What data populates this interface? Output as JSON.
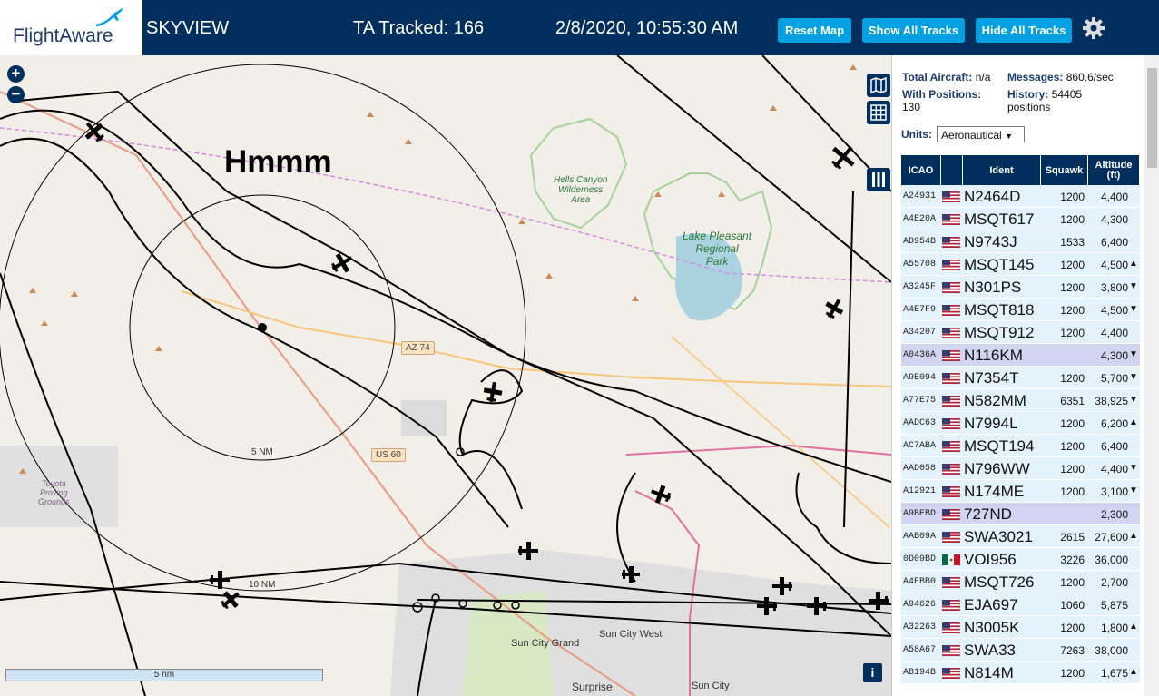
{
  "header": {
    "logo_text": "FlightAware",
    "app_name": "SKYVIEW",
    "tracked": "TA Tracked: 166",
    "datetime": "2/8/2020, 10:55:30 AM",
    "buttons": {
      "reset": "Reset Map",
      "show": "Show All Tracks",
      "hide": "Hide All Tracks"
    }
  },
  "map": {
    "annotation": "Hmmm",
    "zoom_in": "+",
    "zoom_out": "−",
    "ring_label_inner": "5 NM",
    "ring_label_outer": "10 NM",
    "roads": {
      "az74": "AZ 74",
      "us60": "US 60"
    },
    "places": {
      "hells_canyon": "Hells Canyon\nWilderness\nArea",
      "lake_pleasant": "Lake Pleasant\nRegional\nPark",
      "toyota": "Toyota\nProving\nGrounds",
      "sun_city_grand": "Sun City Grand",
      "sun_city_west": "Sun City West",
      "surprise": "Surprise",
      "sun_city": "Sun City"
    },
    "scale_label": "5 nm",
    "info": "i"
  },
  "panel": {
    "total_aircraft_label": "Total Aircraft:",
    "total_aircraft_value": "n/a",
    "messages_label": "Messages:",
    "messages_value": "860.6/sec",
    "with_positions_label": "With Positions:",
    "with_positions_value": "130",
    "history_label": "History:",
    "history_value": "54405",
    "history_unit": "positions",
    "units_label": "Units:",
    "units_value": "Aeronautical",
    "columns": {
      "icao": "ICAO",
      "ident": "Ident",
      "squawk": "Squawk",
      "alt1": "Altitude",
      "alt2": "(ft)"
    },
    "rows": [
      {
        "icao": "A24931",
        "flag": "us",
        "ident": "N2464D",
        "squawk": "1200",
        "alt": "4,400",
        "trend": "",
        "sel": false
      },
      {
        "icao": "A4E20A",
        "flag": "us",
        "ident": "MSQT617",
        "squawk": "1200",
        "alt": "4,300",
        "trend": "",
        "sel": false
      },
      {
        "icao": "AD954B",
        "flag": "us",
        "ident": "N9743J",
        "squawk": "1533",
        "alt": "6,400",
        "trend": "",
        "sel": false
      },
      {
        "icao": "A55708",
        "flag": "us",
        "ident": "MSQT145",
        "squawk": "1200",
        "alt": "4,500",
        "trend": "▲",
        "sel": false
      },
      {
        "icao": "A3245F",
        "flag": "us",
        "ident": "N301PS",
        "squawk": "1200",
        "alt": "3,800",
        "trend": "▼",
        "sel": false
      },
      {
        "icao": "A4E7F9",
        "flag": "us",
        "ident": "MSQT818",
        "squawk": "1200",
        "alt": "4,500",
        "trend": "▼",
        "sel": false
      },
      {
        "icao": "A34207",
        "flag": "us",
        "ident": "MSQT912",
        "squawk": "1200",
        "alt": "4,400",
        "trend": "",
        "sel": false
      },
      {
        "icao": "A0436A",
        "flag": "us",
        "ident": "N116KM",
        "squawk": "",
        "alt": "4,300",
        "trend": "▼",
        "sel": true
      },
      {
        "icao": "A9E094",
        "flag": "us",
        "ident": "N7354T",
        "squawk": "1200",
        "alt": "5,700",
        "trend": "▼",
        "sel": false
      },
      {
        "icao": "A77E75",
        "flag": "us",
        "ident": "N582MM",
        "squawk": "6351",
        "alt": "38,925",
        "trend": "▼",
        "sel": false
      },
      {
        "icao": "AADC63",
        "flag": "us",
        "ident": "N7994L",
        "squawk": "1200",
        "alt": "6,200",
        "trend": "▲",
        "sel": false
      },
      {
        "icao": "AC7ABA",
        "flag": "us",
        "ident": "MSQT194",
        "squawk": "1200",
        "alt": "6,400",
        "trend": "",
        "sel": false
      },
      {
        "icao": "AAD058",
        "flag": "us",
        "ident": "N796WW",
        "squawk": "1200",
        "alt": "4,400",
        "trend": "▼",
        "sel": false
      },
      {
        "icao": "A12921",
        "flag": "us",
        "ident": "N174ME",
        "squawk": "1200",
        "alt": "3,100",
        "trend": "▼",
        "sel": false
      },
      {
        "icao": "A9BEBD",
        "flag": "us",
        "ident": "727ND",
        "squawk": "",
        "alt": "2,300",
        "trend": "",
        "sel": true
      },
      {
        "icao": "AAB09A",
        "flag": "us",
        "ident": "SWA3021",
        "squawk": "2615",
        "alt": "27,600",
        "trend": "▲",
        "sel": false
      },
      {
        "icao": "0D09BD",
        "flag": "mx",
        "ident": "VOI956",
        "squawk": "3226",
        "alt": "36,000",
        "trend": "",
        "sel": false
      },
      {
        "icao": "A4EBB0",
        "flag": "us",
        "ident": "MSQT726",
        "squawk": "1200",
        "alt": "2,700",
        "trend": "",
        "sel": false
      },
      {
        "icao": "A94626",
        "flag": "us",
        "ident": "EJA697",
        "squawk": "1060",
        "alt": "5,875",
        "trend": "",
        "sel": false
      },
      {
        "icao": "A32263",
        "flag": "us",
        "ident": "N3005K",
        "squawk": "1200",
        "alt": "1,800",
        "trend": "▲",
        "sel": false
      },
      {
        "icao": "A58A67",
        "flag": "us",
        "ident": "SWA33",
        "squawk": "7263",
        "alt": "38,000",
        "trend": "",
        "sel": false
      },
      {
        "icao": "AB194B",
        "flag": "us",
        "ident": "N814M",
        "squawk": "1200",
        "alt": "1,675",
        "trend": "▲",
        "sel": false
      }
    ]
  },
  "icons": [
    "gear-icon",
    "plane-logo-icon",
    "map-layers-icon",
    "grid-icon",
    "columns-icon",
    "aircraft-icon",
    "us-flag-icon",
    "mx-flag-icon"
  ],
  "colors": {
    "header": "#002f5d",
    "button": "#00a0e3",
    "row": "#e4f3fb",
    "row_selected": "#d2d5f1",
    "map_bg": "#f2efe9"
  }
}
